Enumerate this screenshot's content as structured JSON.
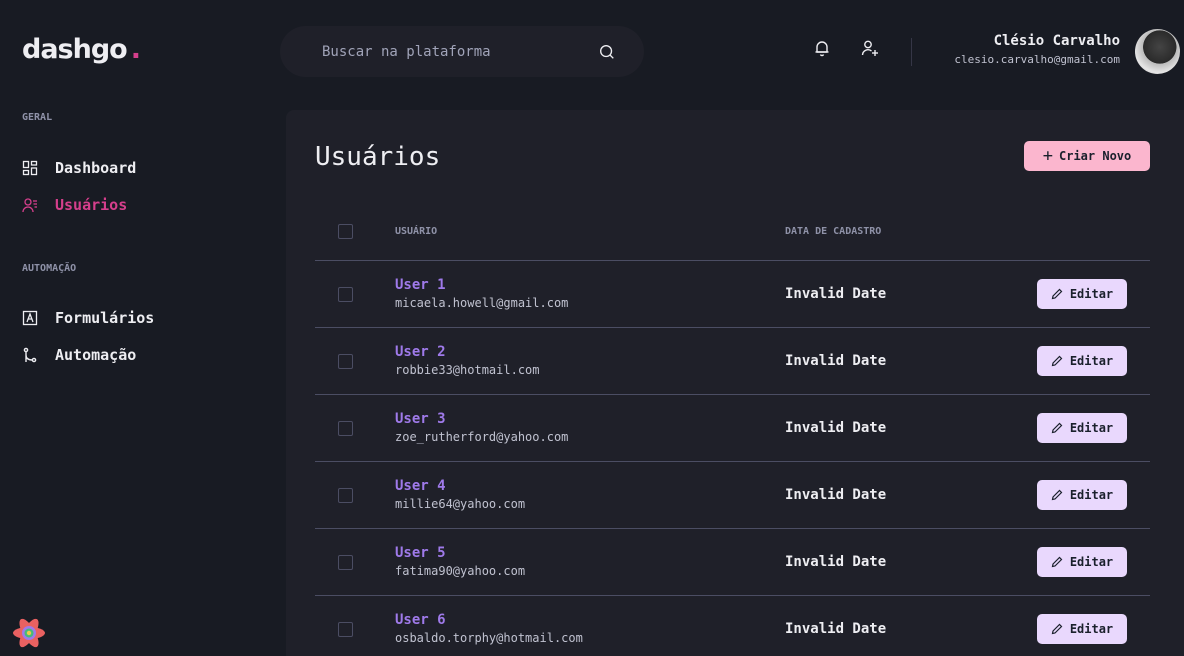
{
  "brand": {
    "name": "dashgo",
    "dot": ".",
    "accent": "#d53f8c"
  },
  "header": {
    "search_placeholder": "Buscar na plataforma",
    "icons": [
      "bell-icon",
      "user-add-icon"
    ],
    "user": {
      "name": "Clésio Carvalho",
      "email": "clesio.carvalho@gmail.com"
    }
  },
  "sidebar": {
    "sections": [
      {
        "title": "GERAL",
        "items": [
          {
            "label": "Dashboard",
            "icon": "dashboard-icon",
            "active": false
          },
          {
            "label": "Usuários",
            "icon": "users-icon",
            "active": true
          }
        ]
      },
      {
        "title": "AUTOMAÇÃO",
        "items": [
          {
            "label": "Formulários",
            "icon": "form-icon",
            "active": false
          },
          {
            "label": "Automação",
            "icon": "git-merge-icon",
            "active": false
          }
        ]
      }
    ]
  },
  "main": {
    "title": "Usuários",
    "create_label": "Criar Novo",
    "create_icon": "plus-icon",
    "table": {
      "columns": [
        "USUÁRIO",
        "DATA DE CADASTRO"
      ],
      "edit_label": "Editar",
      "rows": [
        {
          "name": "User 1",
          "email": "micaela.howell@gmail.com",
          "date": "Invalid Date"
        },
        {
          "name": "User 2",
          "email": "robbie33@hotmail.com",
          "date": "Invalid Date"
        },
        {
          "name": "User 3",
          "email": "zoe_rutherford@yahoo.com",
          "date": "Invalid Date"
        },
        {
          "name": "User 4",
          "email": "millie64@yahoo.com",
          "date": "Invalid Date"
        },
        {
          "name": "User 5",
          "email": "fatima90@yahoo.com",
          "date": "Invalid Date"
        },
        {
          "name": "User 6",
          "email": "osbaldo.torphy@hotmail.com",
          "date": "Invalid Date"
        }
      ]
    }
  },
  "colors": {
    "bg": "#181b23",
    "panel": "#1f2029",
    "pink": "#d53f8c",
    "purple": "#9f7aea",
    "create_btn": "#fbb6ce",
    "edit_btn": "#e9d8fd"
  }
}
